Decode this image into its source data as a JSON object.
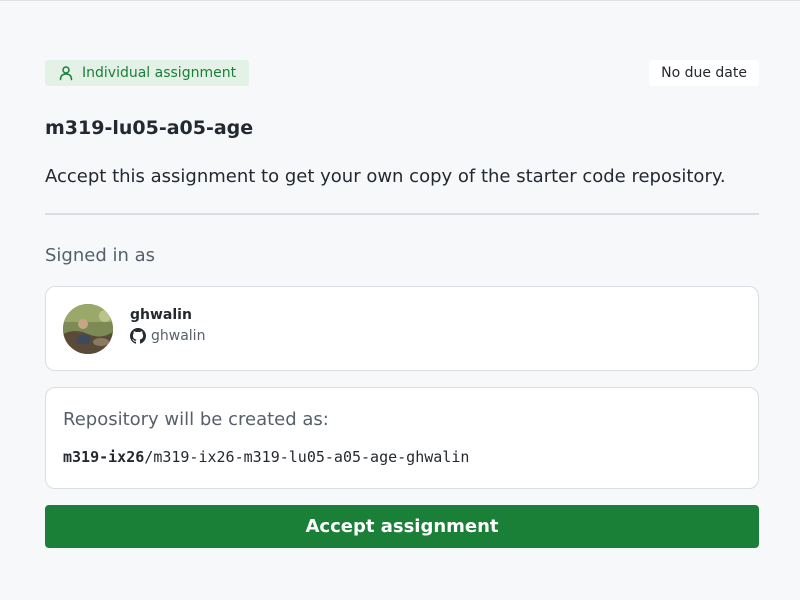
{
  "assignment": {
    "type_label": "Individual assignment",
    "type_icon": "person-icon",
    "due_label": "No due date",
    "title": "m319-lu05-a05-age",
    "description": "Accept this assignment to get your own copy of the starter code repository."
  },
  "signed_in": {
    "label": "Signed in as",
    "display_name": "ghwalin",
    "login": "ghwalin",
    "login_icon": "github-icon"
  },
  "repository": {
    "label": "Repository will be created as:",
    "owner": "m319-ix26",
    "separator": "/",
    "name": "m319-ix26-m319-lu05-a05-age-ghwalin"
  },
  "actions": {
    "accept_label": "Accept assignment"
  },
  "colors": {
    "accent_green": "#1a7f37",
    "pill_background": "#e4f1e6",
    "page_background": "#f6f8fa"
  }
}
